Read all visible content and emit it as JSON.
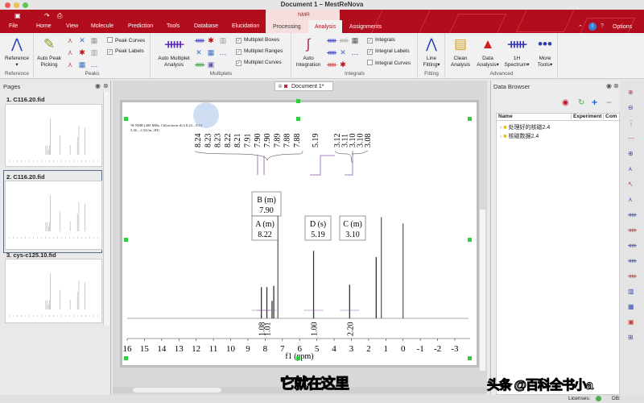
{
  "window": {
    "title": "Document 1 – MestReNova"
  },
  "menu_tabs": [
    "File",
    "Home",
    "View",
    "Molecule",
    "Prediction",
    "Tools",
    "Database",
    "Elucidation"
  ],
  "context": {
    "label": "NMR",
    "tabs": [
      "Processing",
      "Analysis",
      "Assignments"
    ],
    "active": "Analysis"
  },
  "top_right": {
    "options": "Options"
  },
  "ribbon": {
    "reference": {
      "button": "Reference",
      "group": "Reference"
    },
    "peaks": {
      "button": "Auto Peak Picking",
      "group": "Peaks",
      "checks": [
        {
          "label": "Peak Curves",
          "checked": false
        },
        {
          "label": "Peak Labels",
          "checked": true
        }
      ]
    },
    "multiplets": {
      "button": "Auto Multiplet Analysis",
      "group": "Multiplets",
      "checks": [
        {
          "label": "Multiplet Boxes",
          "checked": true
        },
        {
          "label": "Multiplet Ranges",
          "checked": true
        },
        {
          "label": "Multiplet Curves",
          "checked": true
        }
      ]
    },
    "integrals": {
      "button": "Auto Integration",
      "group": "Integrals",
      "checks": [
        {
          "label": "Integrals",
          "checked": true
        },
        {
          "label": "Integral Labels",
          "checked": true
        },
        {
          "label": "Integral Curves",
          "checked": false
        }
      ]
    },
    "fitting": {
      "button": "Line Fitting",
      "group": "Fitting"
    },
    "advanced": {
      "group": "Advanced",
      "buttons": [
        "Clean Analysis",
        "Data Analysis",
        "1H Spectrum",
        "More Tools"
      ]
    }
  },
  "pages": {
    "title": "Pages",
    "items": [
      {
        "num": "1.",
        "name": "C116.20.fid"
      },
      {
        "num": "2.",
        "name": "C116.20.fid"
      },
      {
        "num": "3.",
        "name": "cys-c125.10.fid"
      }
    ],
    "selected": 1
  },
  "document": {
    "tab": "Document 1*"
  },
  "spectrum": {
    "header_line1": "¹H NMR (400 MHz, Chloroform-d) δ 8.24 – 8.19 (m, 1H), 7.92 – 7.86 (m, 1H), 5.19 (s, 2H),",
    "header_line2": "3.36 – 2.54 (m, 2H).",
    "xlabel": "f1 (ppm)",
    "xlim": [
      16,
      -3
    ],
    "ticks": [
      16,
      15,
      14,
      13,
      12,
      11,
      10,
      9,
      8,
      7,
      6,
      5,
      4,
      3,
      2,
      1,
      0,
      -1,
      -2,
      -3
    ],
    "peaks": [
      {
        "ppm": 8.22,
        "i": 25
      },
      {
        "ppm": 7.9,
        "i": 25
      },
      {
        "ppm": 7.6,
        "i": 14
      },
      {
        "ppm": 7.5,
        "i": 26
      },
      {
        "ppm": 7.26,
        "i": 100
      },
      {
        "ppm": 5.19,
        "i": 54
      },
      {
        "ppm": 3.1,
        "i": 27
      },
      {
        "ppm": 1.56,
        "i": 49
      },
      {
        "ppm": 1.26,
        "i": 81
      },
      {
        "ppm": 0.0,
        "i": 76
      }
    ],
    "peak_labels": [
      "8.24",
      "8.23",
      "8.23",
      "8.22",
      "8.21",
      "7.91",
      "7.90",
      "7.90",
      "7.89",
      "7.88",
      "7.88",
      "5.19",
      "3.12",
      "3.11",
      "3.10",
      "3.10",
      "3.08"
    ],
    "multiplets": [
      {
        "name": "B (m)",
        "shift": "7.90"
      },
      {
        "name": "A (m)",
        "shift": "8.22"
      },
      {
        "name": "D (s)",
        "shift": "5.19"
      },
      {
        "name": "C (m)",
        "shift": "3.10"
      }
    ],
    "integrals": [
      {
        "ppm": 8.22,
        "value": "1.08"
      },
      {
        "ppm": 7.9,
        "value": "1.01"
      },
      {
        "ppm": 5.19,
        "value": "1.00"
      },
      {
        "ppm": 3.1,
        "value": "2.20"
      }
    ]
  },
  "browser": {
    "title": "Data Browser",
    "columns": [
      "Name",
      "Experiment",
      "Com"
    ],
    "items": [
      "处理好的核磁2.4",
      "核磁数据2.4"
    ]
  },
  "status": {
    "licenses": "Licenses:",
    "db": "DB:"
  },
  "overlay": {
    "subtitle": "它就在这里",
    "watermark": "头条 @百科全书小a"
  }
}
